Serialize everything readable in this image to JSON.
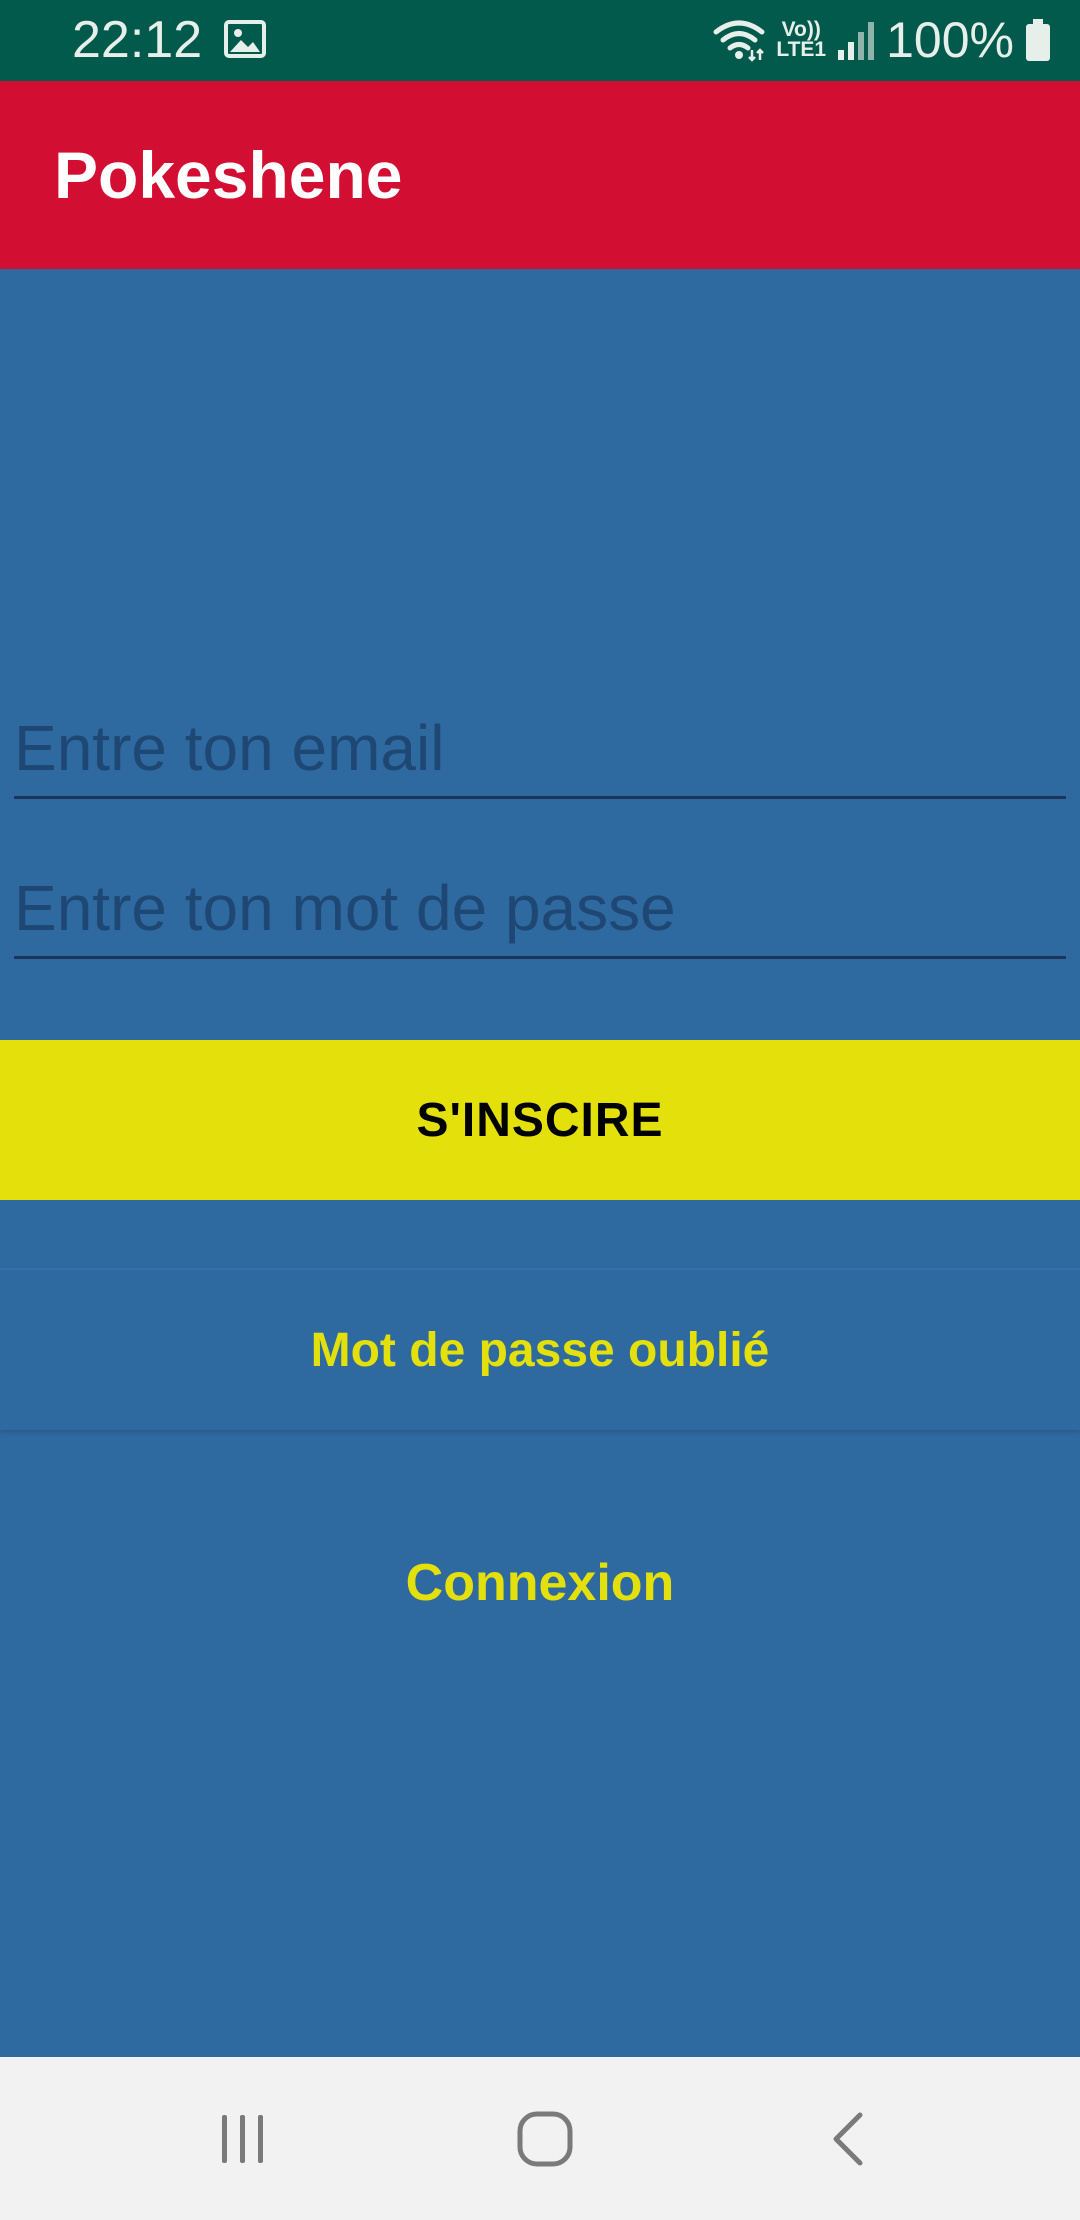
{
  "status_bar": {
    "time": "22:12",
    "gallery_icon": "image-icon",
    "wifi_icon": "wifi-icon",
    "volte_top": "Vo))",
    "volte_bottom": "LTE1",
    "signal_icon": "signal-bars-icon",
    "battery_text": "100%",
    "battery_icon": "battery-icon",
    "background_color": "#025a4c"
  },
  "app_bar": {
    "title": "Pokeshene",
    "background_color": "#d20f32"
  },
  "form": {
    "email_placeholder": "Entre ton email",
    "email_value": "",
    "password_placeholder": "Entre ton mot de passe",
    "password_value": "",
    "signup_label": "S'INSCIRE",
    "forgot_label": "Mot de passe oublié",
    "login_label": "Connexion"
  },
  "theme": {
    "background": "#2e69a0",
    "accent_yellow": "#e3e00b",
    "primary_red": "#d20f32"
  },
  "nav_bar": {
    "recent_icon": "recent-apps-icon",
    "home_icon": "home-icon",
    "back_icon": "back-icon"
  }
}
